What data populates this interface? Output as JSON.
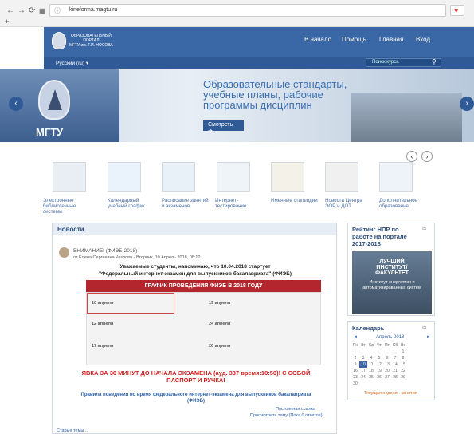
{
  "browser": {
    "url": "kineforma.magtu.ru"
  },
  "header": {
    "logo_lines": [
      "ОБРАЗОВАТЕЛЬНЫЙ",
      "ПОРТАЛ",
      "МГТУ им. Г.И. НОСОВА"
    ],
    "menu": [
      "В начало",
      "Помощь",
      "Главная",
      "Вход"
    ],
    "language": "Русский (ru) ▾",
    "search_placeholder": "Поиск курса"
  },
  "slider": {
    "logo_caption": "МГТУ",
    "headline": "Образовательные стандарты, учебные планы, рабочие программы дисциплин",
    "button": "Смотреть"
  },
  "shortcuts": [
    {
      "label": "Электронные библиотечные системы",
      "icon": "books-icon"
    },
    {
      "label": "Календарный учебный график",
      "icon": "calendar-icon"
    },
    {
      "label": "Расписание занятий и экзаменов",
      "icon": "schedule-icon"
    },
    {
      "label": "Интернет-тестирование",
      "icon": "checklist-icon"
    },
    {
      "label": "Именные стипендии",
      "icon": "coins-icon"
    },
    {
      "label": "Новости Центра ЭОР и ДОТ",
      "icon": "news-icon"
    },
    {
      "label": "Дополнительное образование",
      "icon": "horizon-icon"
    }
  ],
  "news": {
    "title": "Новости",
    "post_title": "ВНИМАНИЕ! (ФИЭБ-2018)",
    "author_line": "от Елена Сергеевна Козлова - Вторник, 10 Апрель 2018, 08:12",
    "line1": "Уважаемые студенты, напоминаю, что 10.04.2018 стартует",
    "line2": "\"Федеральный интернет-экзамен для выпускников бакалавриата\" (ФИЭБ)",
    "banner": "ГРАФИК ПРОВЕДЕНИЯ ФИЭБ В 2018 ГОДУ",
    "dates": [
      "10 апреля",
      "12 апреля",
      "17 апреля",
      "19 апреля",
      "24 апреля",
      "26 апреля"
    ],
    "warning": "ЯВКА ЗА 30 МИНУТ ДО НАЧАЛА ЭКЗАМЕНА (ауд. 337 время:10:50)! С СОБОЙ ПАСПОРТ И РУЧКА!",
    "rules_link": "Правила поведения во время федерального интернет-экзамена для выпускников бакалавриата (ФИЭБ)",
    "permalink": "Постоянная ссылка",
    "view_topic": "Просмотреть тему (Пока 0 ответов)",
    "older": "Старые темы ..."
  },
  "rating": {
    "title": "Рейтинг НПР по работе на портале 2017-2018",
    "best_line1": "ЛУЧШИЙ",
    "best_line2": "ИНСТИТУТ/",
    "best_line3": "ФАКУЛЬТЕТ",
    "institute": "Институт энергетики и автоматизированных систем"
  },
  "calendar": {
    "title": "Календарь",
    "month": "Апрель 2018",
    "weekdays": [
      "Пн",
      "Вт",
      "Ср",
      "Чт",
      "Пт",
      "Сб",
      "Вс"
    ],
    "weeks": [
      [
        "",
        "",
        "",
        "",
        "",
        "",
        "1"
      ],
      [
        "2",
        "3",
        "4",
        "5",
        "6",
        "7",
        "8"
      ],
      [
        "9",
        "10",
        "11",
        "12",
        "13",
        "14",
        "15"
      ],
      [
        "16",
        "17",
        "18",
        "19",
        "20",
        "21",
        "22"
      ],
      [
        "23",
        "24",
        "25",
        "26",
        "27",
        "28",
        "29"
      ],
      [
        "30",
        "",
        "",
        "",
        "",
        "",
        ""
      ]
    ],
    "today": "10",
    "footer": "Текущая неделя - занятия"
  }
}
